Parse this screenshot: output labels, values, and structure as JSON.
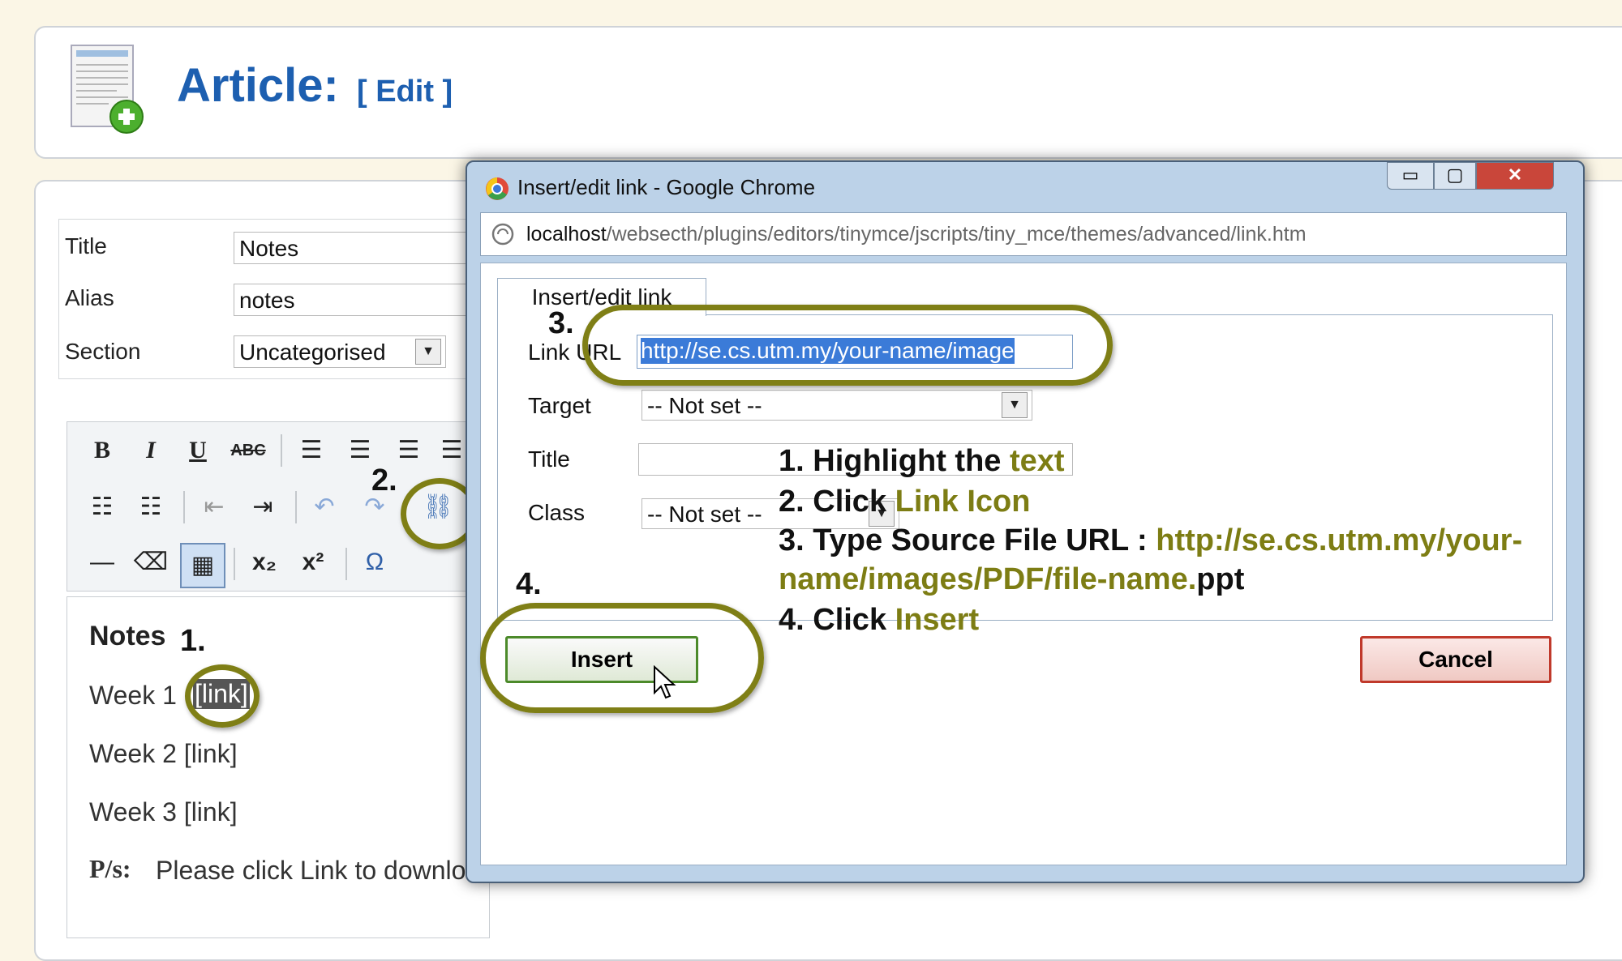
{
  "header": {
    "title": "Article:",
    "edit_label": "[ Edit ]"
  },
  "form": {
    "title_label": "Title",
    "title_value": "Notes",
    "alias_label": "Alias",
    "alias_value": "notes",
    "section_label": "Section",
    "section_value": "Uncategorised"
  },
  "toolbar": {
    "bold": "B",
    "italic": "I",
    "underline": "U",
    "strike": "ABC",
    "subscript": "x₂",
    "superscript": "x²",
    "omega": "Ω"
  },
  "editor": {
    "heading": "Notes",
    "week1": "Week 1",
    "week1_link": "[link]",
    "week2": "Week 2 [link]",
    "week3": "Week 3 [link]",
    "ps_label": "P/s:",
    "ps_text": "Please click Link to downloa"
  },
  "dialog": {
    "window_title": "Insert/edit link - Google Chrome",
    "url_host": "localhost",
    "url_path": "/websecth/plugins/editors/tinymce/jscripts/tiny_mce/themes/advanced/link.htm",
    "tab_label": "Insert/edit link",
    "link_url_label": "Link URL",
    "link_url_value": "http://se.cs.utm.my/your-name/image",
    "target_label": "Target",
    "target_value": "-- Not set --",
    "title_label": "Title",
    "title_value": "",
    "class_label": "Class",
    "class_value": "-- Not set --",
    "insert_label": "Insert",
    "cancel_label": "Cancel"
  },
  "annotations": {
    "step1_marker": "1.",
    "step2_marker": "2.",
    "step3_marker": "3.",
    "step4_marker": "4.",
    "line1_prefix": "1. Highlight the ",
    "line1_hl": "text",
    "line2_prefix": "2. Click ",
    "line2_hl": "Link Icon",
    "line3_prefix": "3. Type Source File URL : ",
    "line3_hl_a": "http://se.cs.utm.my/your-",
    "line3_hl_b": "name/images/PDF/file-name.",
    "line3_suffix": "ppt",
    "line4_prefix": "4. Click ",
    "line4_hl": "Insert"
  },
  "colors": {
    "accent": "#1d5fb0",
    "highlight": "#7d7d14",
    "ring": "#7f7f16",
    "cancel_border": "#c0392b"
  }
}
